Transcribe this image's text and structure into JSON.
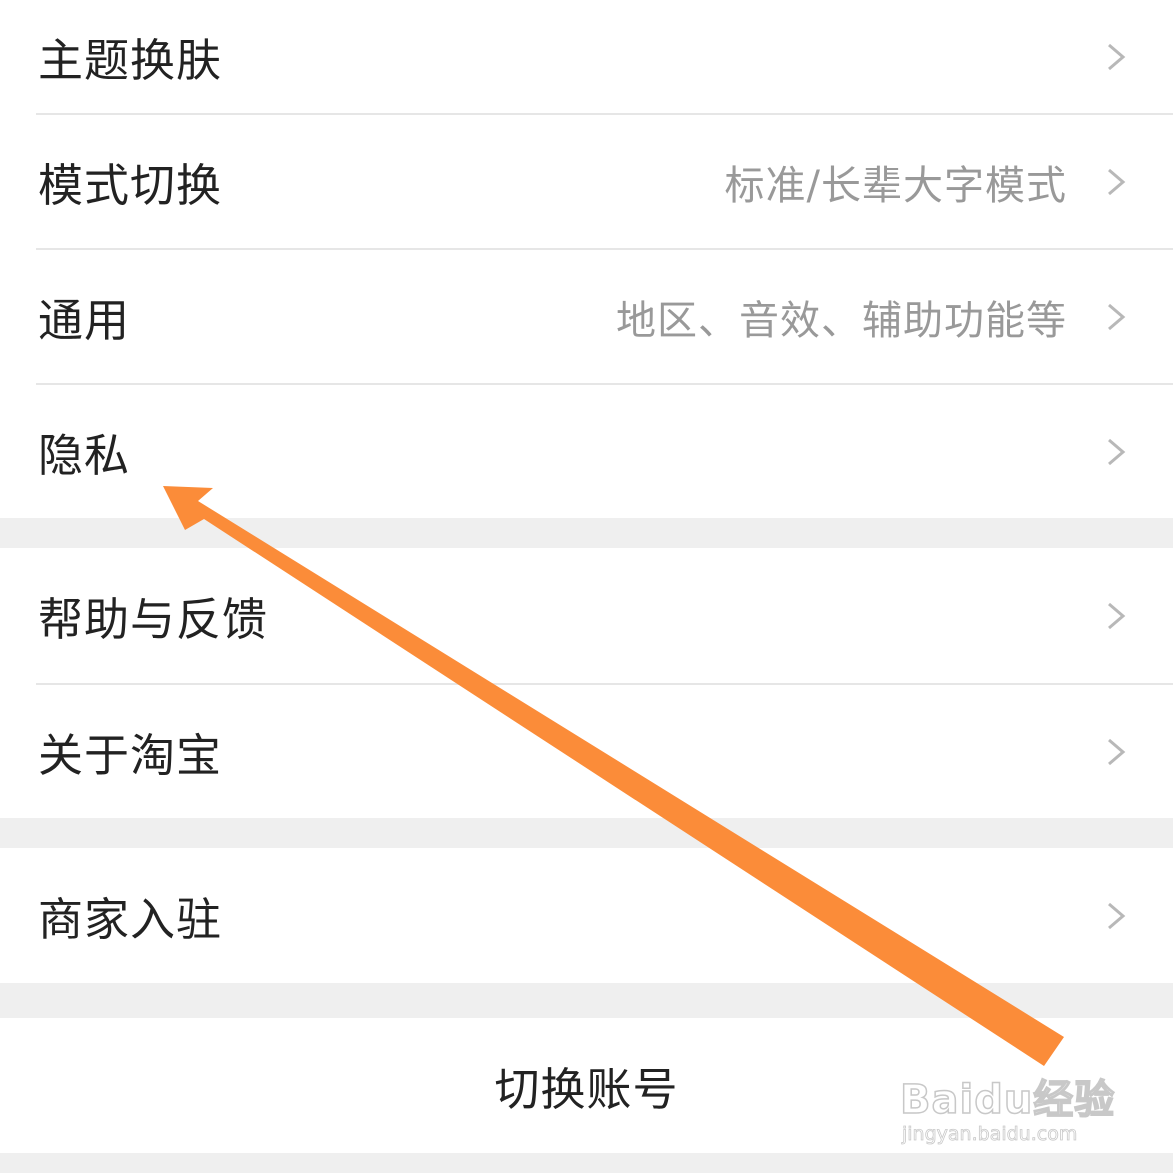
{
  "settings": {
    "items": [
      {
        "label": "主题换肤",
        "value": ""
      },
      {
        "label": "模式切换",
        "value": "标准/长辈大字模式"
      },
      {
        "label": "通用",
        "value": "地区、音效、辅助功能等"
      },
      {
        "label": "隐私",
        "value": ""
      },
      {
        "label": "帮助与反馈",
        "value": ""
      },
      {
        "label": "关于淘宝",
        "value": ""
      },
      {
        "label": "商家入驻",
        "value": ""
      }
    ],
    "switch_account": "切换账号"
  },
  "annotation": {
    "arrow_color": "#fb8c39"
  },
  "watermark": {
    "brand": "Baidu经验",
    "url": "jingyan.baidu.com"
  },
  "icons": {
    "chevron": "chevron-right-icon"
  }
}
